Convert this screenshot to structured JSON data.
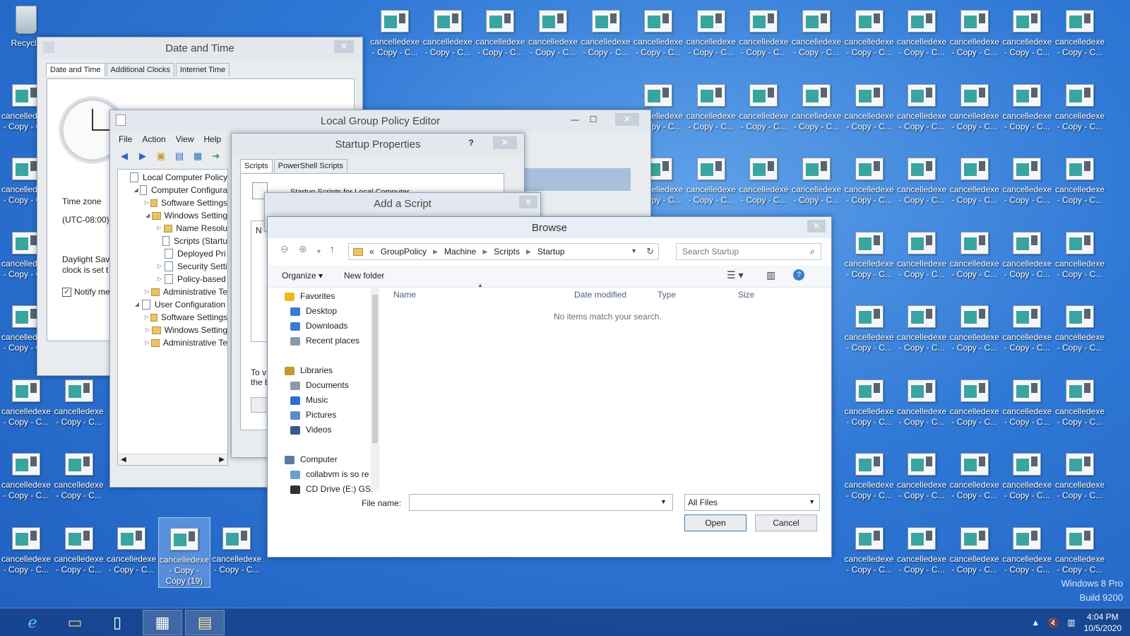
{
  "desktop": {
    "recycle_label": "Recycle",
    "icon_label": "cancelledexe - Copy - C...",
    "selected_icon_label": "cancelledexe - Copy - Copy (19)",
    "watermark_line1": "Windows 8 Pro",
    "watermark_line2": "Build 9200"
  },
  "date_time": {
    "title": "Date and Time",
    "tabs": [
      "Date and Time",
      "Additional Clocks",
      "Internet Time"
    ],
    "time_zone_label": "Time zone",
    "time_zone_value": "(UTC-08:00)",
    "daylight_line1": "Daylight Sav",
    "daylight_line2": "clock is set t",
    "notify_label": "Notify me"
  },
  "gpedit": {
    "title": "Local Group Policy Editor",
    "menu": [
      "File",
      "Action",
      "View",
      "Help"
    ],
    "tree": [
      {
        "label": "Local Computer Policy",
        "indent": 0,
        "toggle": "",
        "icon": "doc"
      },
      {
        "label": "Computer Configura",
        "indent": 1,
        "toggle": "◢",
        "icon": "doc"
      },
      {
        "label": "Software Settings",
        "indent": 2,
        "toggle": "▷",
        "icon": "folder"
      },
      {
        "label": "Windows Setting",
        "indent": 2,
        "toggle": "◢",
        "icon": "folder"
      },
      {
        "label": "Name Resolu",
        "indent": 3,
        "toggle": "▷",
        "icon": "folder"
      },
      {
        "label": "Scripts (Startu",
        "indent": 3,
        "toggle": "",
        "icon": "doc"
      },
      {
        "label": "Deployed Pri",
        "indent": 3,
        "toggle": "",
        "icon": "doc"
      },
      {
        "label": "Security Setti",
        "indent": 3,
        "toggle": "▷",
        "icon": "doc"
      },
      {
        "label": "Policy-based",
        "indent": 3,
        "toggle": "▷",
        "icon": "doc"
      },
      {
        "label": "Administrative Te",
        "indent": 2,
        "toggle": "▷",
        "icon": "folder"
      },
      {
        "label": "User Configuration",
        "indent": 1,
        "toggle": "◢",
        "icon": "doc"
      },
      {
        "label": "Software Settings",
        "indent": 2,
        "toggle": "▷",
        "icon": "folder"
      },
      {
        "label": "Windows Setting",
        "indent": 2,
        "toggle": "▷",
        "icon": "folder"
      },
      {
        "label": "Administrative Te",
        "indent": 2,
        "toggle": "▷",
        "icon": "folder"
      }
    ]
  },
  "startup": {
    "title": "Startup Properties",
    "help": "?",
    "tabs": [
      "Scripts",
      "PowerShell Scripts"
    ],
    "heading": "Startup Scripts for Local Computer",
    "frag1": "N",
    "frag2": "To v",
    "frag3": "the b"
  },
  "add_script": {
    "title": "Add a Script"
  },
  "browse": {
    "title": "Browse",
    "path": [
      "«",
      "GroupPolicy",
      "Machine",
      "Scripts",
      "Startup"
    ],
    "search_placeholder": "Search Startup",
    "organize": "Organize",
    "new_folder": "New folder",
    "columns": [
      "Name",
      "Date modified",
      "Type",
      "Size"
    ],
    "empty_message": "No items match your search.",
    "nav": [
      {
        "label": "Favorites",
        "icon": "star",
        "group": true
      },
      {
        "label": "Desktop",
        "icon": "desktop",
        "group": false
      },
      {
        "label": "Downloads",
        "icon": "downloads",
        "group": false
      },
      {
        "label": "Recent places",
        "icon": "recent",
        "group": false
      },
      {
        "label": "",
        "icon": "",
        "group": true
      },
      {
        "label": "Libraries",
        "icon": "libraries",
        "group": true
      },
      {
        "label": "Documents",
        "icon": "documents",
        "group": false
      },
      {
        "label": "Music",
        "icon": "music",
        "group": false
      },
      {
        "label": "Pictures",
        "icon": "pictures",
        "group": false
      },
      {
        "label": "Videos",
        "icon": "videos",
        "group": false
      },
      {
        "label": "",
        "icon": "",
        "group": true
      },
      {
        "label": "Computer",
        "icon": "computer",
        "group": true
      },
      {
        "label": "collabvm is so re",
        "icon": "drive",
        "group": false
      },
      {
        "label": "CD Drive (E:) GSP",
        "icon": "cd",
        "group": false
      }
    ],
    "file_name_label": "File name:",
    "file_name_value": "",
    "file_type": "All Files",
    "open_label": "Open",
    "cancel_label": "Cancel"
  },
  "taskbar": {
    "time": "4:04 PM",
    "date": "10/5/2020"
  },
  "colors": {
    "desktop_bg": "#2f78d6",
    "accent": "#3c7fb1"
  }
}
